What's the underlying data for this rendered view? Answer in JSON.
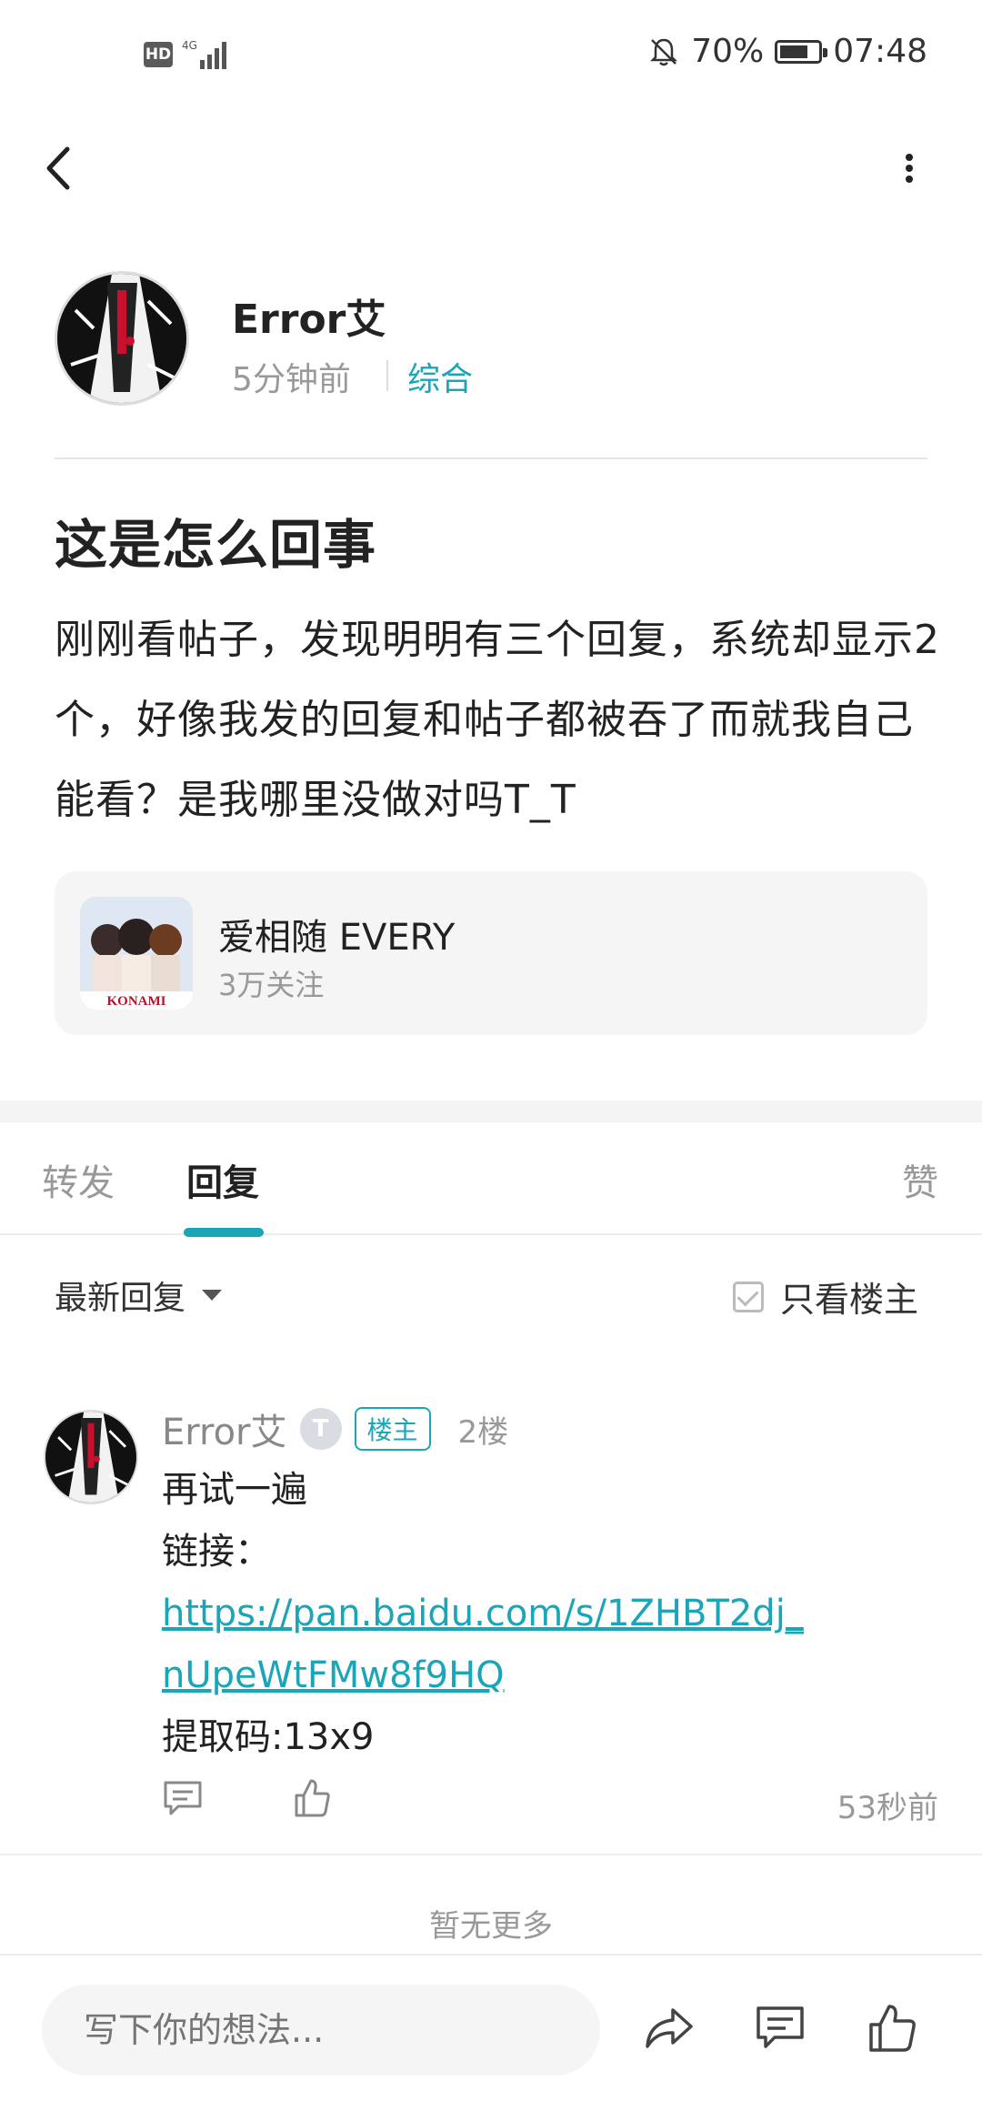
{
  "status_bar": {
    "hd": "HD",
    "battery_percent": "70%",
    "time": "07:48"
  },
  "post": {
    "author": "Error艾",
    "time": "5分钟前",
    "category": "综合",
    "title": "这是怎么回事",
    "body": "刚刚看帖子，发现明明有三个回复，系统却显示2个，好像我发的回复和帖子都被吞了而就我自己能看？是我哪里没做对吗T_T"
  },
  "forum": {
    "name": "爱相随 EVERY",
    "followers": "3万关注",
    "icon_label": "KONAMI"
  },
  "tabs": {
    "forward": "转发",
    "reply": "回复",
    "like": "赞"
  },
  "filter": {
    "sort": "最新回复",
    "only_op": "只看楼主"
  },
  "reply": {
    "user": "Error艾",
    "level_badge": "T",
    "op_badge": "楼主",
    "floor": "2楼",
    "line1": "再试一遍",
    "line2": "链接：",
    "link": "https://pan.baidu.com/s/1ZHBT2dj_nUpeWtFMw8f9HQ",
    "line3": "提取码:13x9",
    "time": "53秒前"
  },
  "no_more": "暂无更多",
  "bottom_bar": {
    "placeholder": "写下你的想法..."
  },
  "colors": {
    "accent": "#1ba6b8"
  }
}
